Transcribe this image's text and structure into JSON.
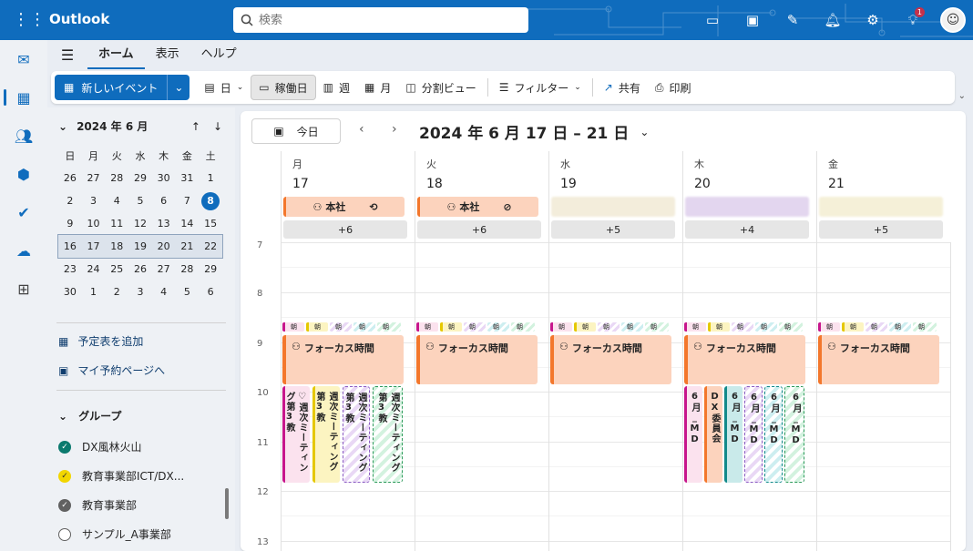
{
  "app": {
    "brand": "Outlook"
  },
  "search": {
    "placeholder": "検索"
  },
  "notification_badge": "1",
  "menu": {
    "tabs": [
      "ホーム",
      "表示",
      "ヘルプ"
    ]
  },
  "ribbon": {
    "new_event": "新しいイベント",
    "day": "日",
    "workweek": "稼働日",
    "week": "週",
    "month": "月",
    "split": "分割ビュー",
    "filter": "フィルター",
    "share": "共有",
    "print": "印刷"
  },
  "mini": {
    "title": "2024 年 6 月",
    "weekdays": [
      "日",
      "月",
      "火",
      "水",
      "木",
      "金",
      "土"
    ],
    "weeks": [
      [
        "26",
        "27",
        "28",
        "29",
        "30",
        "31",
        "1"
      ],
      [
        "2",
        "3",
        "4",
        "5",
        "6",
        "7",
        "8"
      ],
      [
        "9",
        "10",
        "11",
        "12",
        "13",
        "14",
        "15"
      ],
      [
        "16",
        "17",
        "18",
        "19",
        "20",
        "21",
        "22"
      ],
      [
        "23",
        "24",
        "25",
        "26",
        "27",
        "28",
        "29"
      ],
      [
        "30",
        "1",
        "2",
        "3",
        "4",
        "5",
        "6"
      ]
    ],
    "today": "8"
  },
  "sidebar": {
    "add_calendar": "予定表を追加",
    "booking": "マイ予約ページへ",
    "groups_label": "グループ",
    "groups": [
      {
        "name": "DX風林火山",
        "color": "#0b7a6e",
        "checked": true
      },
      {
        "name": "教育事業部ICT/DX...",
        "color": "#f2d600",
        "checked": true
      },
      {
        "name": "教育事業部",
        "color": "#616161",
        "checked": true
      },
      {
        "name": "サンプル_A事業部",
        "color": "",
        "checked": false
      }
    ]
  },
  "calendar": {
    "today_button": "今日",
    "range": "2024 年 6 月 17 日 – 21 日",
    "days": [
      {
        "name": "月",
        "date": "17",
        "allday": "本社",
        "more": "+6"
      },
      {
        "name": "火",
        "date": "18",
        "allday": "本社",
        "more": "+6"
      },
      {
        "name": "水",
        "date": "19",
        "allday": "",
        "more": "+5"
      },
      {
        "name": "木",
        "date": "20",
        "allday": "",
        "more": "+4"
      },
      {
        "name": "金",
        "date": "21",
        "allday": "",
        "more": "+5"
      }
    ],
    "hours": [
      "7",
      "8",
      "9",
      "10",
      "11",
      "12",
      "13"
    ],
    "focus_label": "フォーカス時間",
    "strip_label": "朝",
    "weekly_mtg": "週次ミーティング第3教",
    "events_thu": [
      "6月_MD",
      "DX委員会",
      "6月_MD",
      "6月_MD",
      "6月_MD",
      "6月_MD"
    ]
  }
}
